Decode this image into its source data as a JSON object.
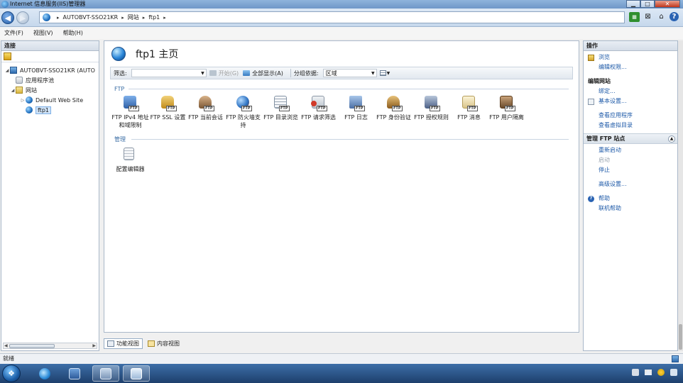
{
  "window": {
    "title": "Internet 信息服务(IIS)管理器",
    "btn_min": "▁",
    "btn_max": "□",
    "btn_close": "✕"
  },
  "address": {
    "segments": [
      "AUTOBVT-SSO21KR",
      "网站",
      "ftp1"
    ],
    "arrow": "▸"
  },
  "toolbar": {
    "home_icon": "server-icon",
    "stop_icon": "stop-icon",
    "help_label": "?"
  },
  "menu": {
    "items": [
      "文件(F)",
      "视图(V)",
      "帮助(H)"
    ]
  },
  "connections": {
    "header": "连接",
    "tree": [
      {
        "label": "AUTOBVT-SSO21KR (AUTO",
        "twisty": "◢",
        "icon": "server-icon"
      },
      {
        "label": "应用程序池",
        "twisty": "",
        "icon": "app-pool-icon"
      },
      {
        "label": "网站",
        "twisty": "◢",
        "icon": "sites-folder-icon"
      },
      {
        "label": "Default Web Site",
        "twisty": "▷",
        "icon": "globe-icon"
      },
      {
        "label": "ftp1",
        "twisty": "",
        "icon": "globe-icon"
      }
    ]
  },
  "page": {
    "title": "ftp1 主页",
    "filter": {
      "label": "筛选:",
      "go": "开始(G)",
      "show_all": "全部显示(A)",
      "group_label": "分组依据:",
      "group_value": "区域"
    },
    "sections": [
      {
        "title": "FTP",
        "features": [
          {
            "label": "FTP IPv4 地址和域限制",
            "icon": "ftp-ip-restrictions-icon",
            "color": "#3a6fbf"
          },
          {
            "label": "FTP SSL 设置",
            "icon": "ftp-ssl-lock-icon",
            "color": "#d6a21e"
          },
          {
            "label": "FTP 当前会话",
            "icon": "ftp-sessions-icon",
            "color": "#8a6b4a"
          },
          {
            "label": "FTP 防火墙支持",
            "icon": "ftp-firewall-icon",
            "color": "#3a5f9a"
          },
          {
            "label": "FTP 目录浏览",
            "icon": "ftp-directory-icon",
            "color": "#9aa6b3"
          },
          {
            "label": "FTP 请求筛选",
            "icon": "ftp-request-filter-icon",
            "color": "#c0392b"
          },
          {
            "label": "FTP 日志",
            "icon": "ftp-log-icon",
            "color": "#5b7fb0"
          },
          {
            "label": "FTP 身份验证",
            "icon": "ftp-authentication-icon",
            "color": "#b07a2a"
          },
          {
            "label": "FTP 授权规则",
            "icon": "ftp-authorization-icon",
            "color": "#5a6f9a"
          },
          {
            "label": "FTP 消息",
            "icon": "ftp-messages-icon",
            "color": "#d9c48a"
          },
          {
            "label": "FTP 用户隔离",
            "icon": "ftp-user-isolation-icon",
            "color": "#7a5a3a"
          }
        ]
      },
      {
        "title": "管理",
        "features": [
          {
            "label": "配置编辑器",
            "icon": "config-editor-icon",
            "color": "#c8cdd3"
          }
        ]
      }
    ],
    "tabs": [
      "功能视图",
      "内容视图"
    ]
  },
  "actions": {
    "header": "操作",
    "browse": "浏览",
    "edit_permissions": "编辑权限...",
    "edit_site_header": "编辑网站",
    "bindings": "绑定...",
    "basic_settings": "基本设置...",
    "view_apps": "查看应用程序",
    "view_vdirs": "查看虚拟目录",
    "manage_header": "管理 FTP 站点",
    "restart": "重新启动",
    "start": "启动",
    "stop": "停止",
    "advanced": "高级设置...",
    "help": "帮助",
    "online_help": "联机帮助"
  },
  "status": {
    "text": "就绪"
  },
  "taskbar": {
    "start_glyph": "❖"
  }
}
